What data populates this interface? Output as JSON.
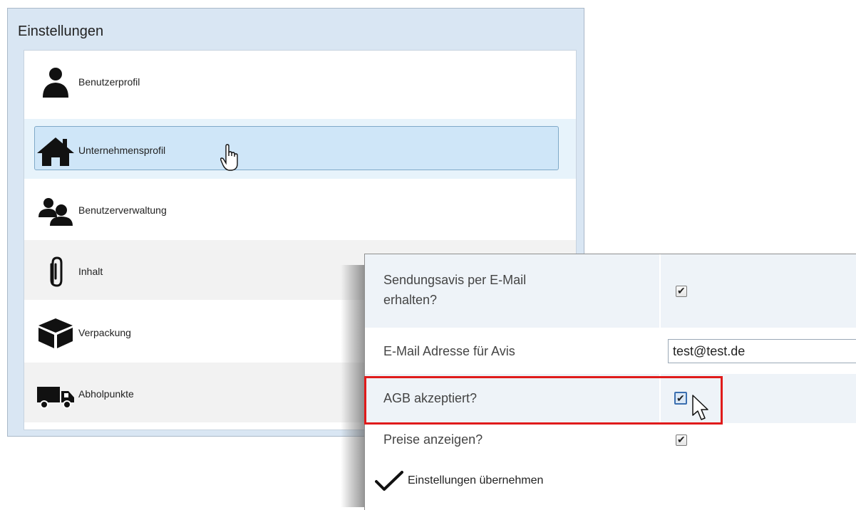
{
  "settings": {
    "title": "Einstellungen",
    "items": [
      {
        "label": "Benutzerprofil",
        "icon": "user-icon"
      },
      {
        "label": "Unternehmensprofil",
        "icon": "house-icon",
        "state": "hovered"
      },
      {
        "label": "Benutzerverwaltung",
        "icon": "users-icon"
      },
      {
        "label": "Inhalt",
        "icon": "paperclip-icon"
      },
      {
        "label": "Verpackung",
        "icon": "box-icon"
      },
      {
        "label": "Abholpunkte",
        "icon": "truck-icon"
      }
    ]
  },
  "form": {
    "rows": [
      {
        "label_line1": "Sendungsavis per E-Mail",
        "label_line2": "erhalten?",
        "checked": true
      },
      {
        "label": "E-Mail Adresse für Avis",
        "value": "test@test.de"
      },
      {
        "label": "AGB akzeptiert?",
        "checked": true,
        "highlighted": true
      },
      {
        "label": "Preise anzeigen?",
        "checked": true
      }
    ],
    "submit_label": "Einstellungen übernehmen"
  },
  "colors": {
    "panel_bg": "#d9e6f3",
    "selected_item": "#cfe6f8",
    "highlight_border": "#e01b1b"
  }
}
